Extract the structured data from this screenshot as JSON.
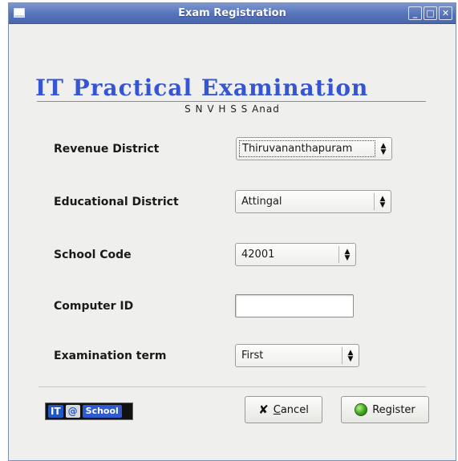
{
  "window": {
    "title": "Exam Registration",
    "controls": {
      "minimize": "_",
      "maximize": "□",
      "close": "✕"
    }
  },
  "header": {
    "title": "IT Practical Examination",
    "school_name": "S N V H S S Anad"
  },
  "form": {
    "revenue_district": {
      "label": "Revenue District",
      "value": "Thiruvananthapuram"
    },
    "educational_district": {
      "label": "Educational District",
      "value": "Attingal"
    },
    "school_code": {
      "label": "School Code",
      "value": "42001"
    },
    "computer_id": {
      "label": "Computer ID",
      "value": ""
    },
    "examination_term": {
      "label": "Examination term",
      "value": "First"
    }
  },
  "logo": {
    "it": "IT",
    "at": "@",
    "school": "School"
  },
  "buttons": {
    "cancel": {
      "mnemonic": "C",
      "rest": "ancel",
      "icon": "x-cross-icon"
    },
    "register": {
      "label": "Register",
      "icon": "green-circle-icon"
    }
  },
  "colors": {
    "heading": "#3456d4",
    "titlebar": "#5673b9",
    "window_bg": "#efefed"
  }
}
